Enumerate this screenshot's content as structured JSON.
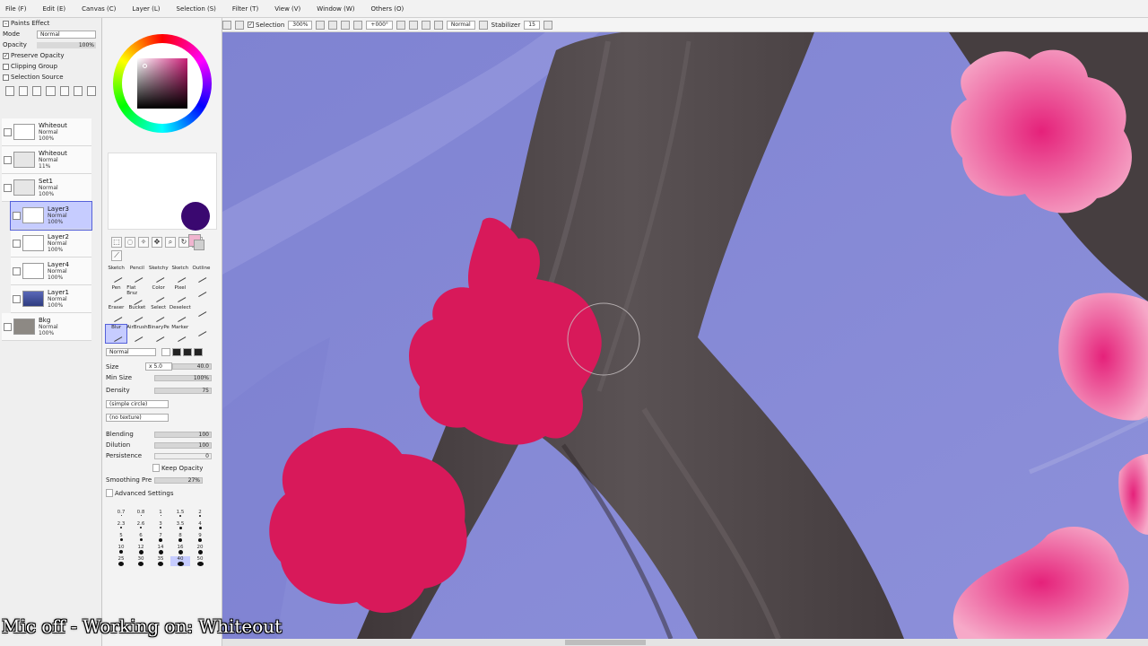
{
  "menu": [
    "File (F)",
    "Edit (E)",
    "Canvas (C)",
    "Layer (L)",
    "Selection (S)",
    "Filter (T)",
    "View (V)",
    "Window (W)",
    "Others (O)"
  ],
  "toolbar": {
    "selection_label": "Selection",
    "zoom": "300%",
    "rotation": "+000°",
    "blend_mode": "Normal",
    "stabilizer_label": "Stabilizer",
    "stabilizer_value": "15"
  },
  "layer_panel": {
    "paint_effect": "Paints Effect",
    "mode_label": "Mode",
    "mode_value": "Normal",
    "opacity_label": "Opacity",
    "opacity_value": "100%",
    "preserve_opacity": "Preserve Opacity",
    "clipping_group": "Clipping Group",
    "selection_source": "Selection Source",
    "layers": [
      {
        "name": "Whiteout",
        "mode": "Normal",
        "opacity": "100%",
        "thumb": "white",
        "selected": false
      },
      {
        "name": "Whiteout",
        "mode": "Normal",
        "opacity": "11%",
        "thumb": "folder",
        "selected": false
      },
      {
        "name": "Set1",
        "mode": "Normal",
        "opacity": "100%",
        "thumb": "folder",
        "selected": false
      },
      {
        "name": "Layer3",
        "mode": "Normal",
        "opacity": "100%",
        "thumb": "white",
        "selected": true
      },
      {
        "name": "Layer2",
        "mode": "Normal",
        "opacity": "100%",
        "thumb": "white",
        "selected": false
      },
      {
        "name": "Layer4",
        "mode": "Normal",
        "opacity": "100%",
        "thumb": "white",
        "selected": false
      },
      {
        "name": "Layer1",
        "mode": "Normal",
        "opacity": "100%",
        "thumb": "dark",
        "selected": false
      },
      {
        "name": "Bkg",
        "mode": "Normal",
        "opacity": "100%",
        "thumb": "bg",
        "selected": false
      }
    ]
  },
  "tool_panel": {
    "current_color": "#3a0870",
    "brushes": [
      "Sketch",
      "Pencil",
      "Sketchy",
      "Sketch",
      "Outline",
      "Pen",
      "Flat Brsz",
      "Color",
      "Pixel",
      "",
      "Eraser",
      "Bucket",
      "Select",
      "Deselect",
      "",
      "Blur",
      "AirBrush",
      "BinaryPe",
      "Marker",
      ""
    ],
    "selected_brush_index": 15,
    "blend_mode": "Normal",
    "size_label": "Size",
    "size_multiplier": "x 5.0",
    "size_value": "40.0",
    "min_size_label": "Min Size",
    "min_size_value": "100%",
    "density_label": "Density",
    "density_value": "75",
    "shape": "(simple circle)",
    "texture": "(no texture)",
    "blending_label": "Blending",
    "blending_value": "100",
    "dilution_label": "Dilution",
    "dilution_value": "100",
    "persistence_label": "Persistence",
    "persistence_value": "0",
    "keep_opacity": "Keep Opacity",
    "smoothing_label": "Smoothing Pre",
    "smoothing_value": "27%",
    "advanced_settings": "Advanced Settings",
    "tip_sizes": [
      "0.7",
      "0.8",
      "1",
      "1.5",
      "2",
      "2.3",
      "2.6",
      "3",
      "3.5",
      "4",
      "5",
      "6",
      "7",
      "8",
      "9",
      "10",
      "12",
      "14",
      "16",
      "20",
      "25",
      "30",
      "35",
      "40",
      "50"
    ],
    "selected_tip_index": 23
  },
  "overlay": {
    "caption": "Mic off - Working on: Whiteout"
  },
  "colors": {
    "sky": "#8a8ed8",
    "trunk": "#4a4244",
    "blossom": "#d8195a",
    "pink_flower": "#f06aa6"
  }
}
